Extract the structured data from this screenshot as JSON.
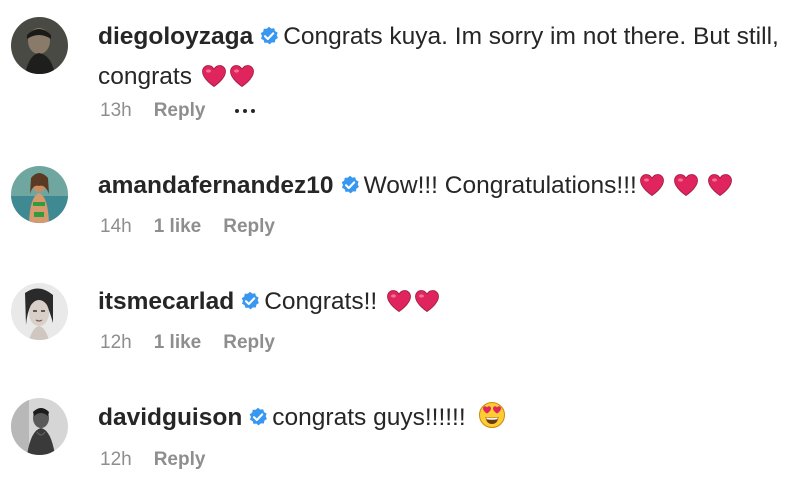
{
  "comments": [
    {
      "username": "diegoloyzaga",
      "text": "Congrats kuya. Im sorry im not there. But still, congrats",
      "emoji": "red-heart x2",
      "time": "13h",
      "likes": "",
      "reply": "Reply"
    },
    {
      "username": "amandafernandez10",
      "text": "Wow!!! Congratulations!!!",
      "emoji": "red-heart x3",
      "time": "14h",
      "likes": "1 like",
      "reply": "Reply"
    },
    {
      "username": "itsmecarlad",
      "text": "Congrats!!",
      "emoji": "red-heart x2",
      "time": "12h",
      "likes": "1 like",
      "reply": "Reply"
    },
    {
      "username": "davidguison",
      "text": "congrats guys!!!!!!",
      "emoji": "heart-eyes-face",
      "time": "12h",
      "likes": "",
      "reply": "Reply"
    }
  ],
  "colors": {
    "text": "#262626",
    "meta": "#8e8e8e",
    "verified": "#3897f0",
    "heart": "#e0245e"
  }
}
